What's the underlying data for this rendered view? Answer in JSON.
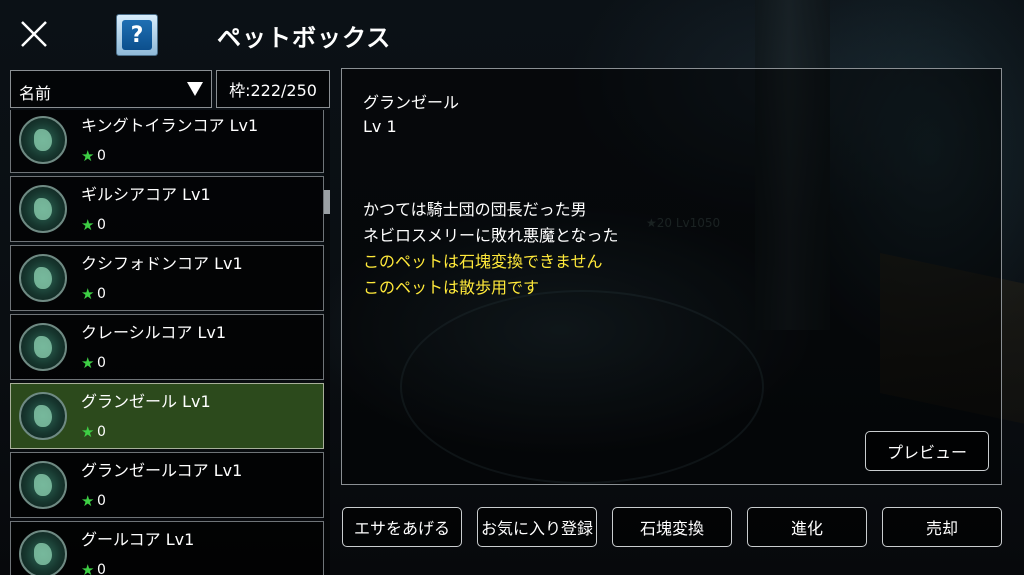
{
  "header": {
    "title": "ペットボックス",
    "close_icon": "close-icon",
    "help_icon": "help-icon",
    "help_glyph": "?"
  },
  "sort": {
    "label": "名前"
  },
  "capacity": "枠:222/250",
  "pets": [
    {
      "name": "キングトイランコア Lv1",
      "rank": "0",
      "selected": false
    },
    {
      "name": "ギルシアコア Lv1",
      "rank": "0",
      "selected": false
    },
    {
      "name": "クシフォドンコア Lv1",
      "rank": "0",
      "selected": false
    },
    {
      "name": "クレーシルコア Lv1",
      "rank": "0",
      "selected": false
    },
    {
      "name": "グランゼール Lv1",
      "rank": "0",
      "selected": true
    },
    {
      "name": "グランゼールコア Lv1",
      "rank": "0",
      "selected": false
    },
    {
      "name": "グールコア Lv1",
      "rank": "0",
      "selected": false
    }
  ],
  "detail": {
    "name": "グランゼール",
    "level": "Lv 1",
    "description": [
      "かつては騎士団の団長だった男",
      "ネビロスメリーに敗れ悪魔となった"
    ],
    "warnings": [
      "このペットは石塊変換できません",
      "このペットは散歩用です"
    ],
    "preview_label": "プレビュー"
  },
  "actions": [
    "エサをあげる",
    "お気に入り登録",
    "石塊変換",
    "進化",
    "売却"
  ],
  "background_text": "★20 Lv1050",
  "colors": {
    "selected_row": "#2c4a1c",
    "warning_text": "#ffe93a",
    "star": "#3ecf45"
  }
}
